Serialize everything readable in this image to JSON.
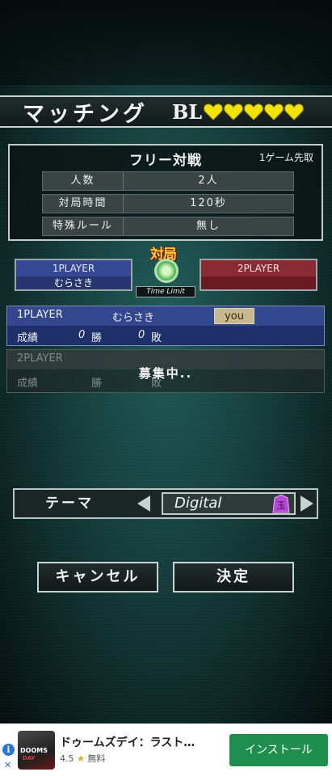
{
  "header": {
    "title": "マッチング",
    "bl_label": "BL",
    "hearts": 5,
    "heart_color": "#f2e400"
  },
  "rules": {
    "title": "フリー対戦",
    "sub": "1ゲーム先取",
    "rows": [
      {
        "key": "人数",
        "value": "2人"
      },
      {
        "key": "対局時間",
        "value": "120秒"
      },
      {
        "key": "特殊ルール",
        "value": "無し"
      }
    ]
  },
  "players": {
    "p1_label": "1PLAYER",
    "p1_name": "むらさき",
    "p2_label": "2PLAYER",
    "vs_label": "対局",
    "time_limit": "Time Limit"
  },
  "status": {
    "p1": {
      "label": "1PLAYER",
      "name": "むらさき",
      "you": "you",
      "record_label": "成績",
      "wins": "0",
      "wins_unit": "勝",
      "losses": "0",
      "losses_unit": "敗"
    },
    "p2": {
      "label": "2PLAYER",
      "record_label": "成績",
      "wins_unit": "勝",
      "losses_unit": "敗",
      "recruiting": "募集中.."
    }
  },
  "theme": {
    "label": "テーマ",
    "value": "Digital",
    "piece_glyph": "玉",
    "piece_color": "#b848d8"
  },
  "buttons": {
    "cancel": "キャンセル",
    "confirm": "決定"
  },
  "ad": {
    "info": "i",
    "close": "✕",
    "app_name": "ドゥームズデイ：ラスト…",
    "rating": "4.5",
    "star": "★",
    "price": "無料",
    "install": "インストール",
    "thumb_title": "DOOMS",
    "thumb_sub": "DAY"
  }
}
